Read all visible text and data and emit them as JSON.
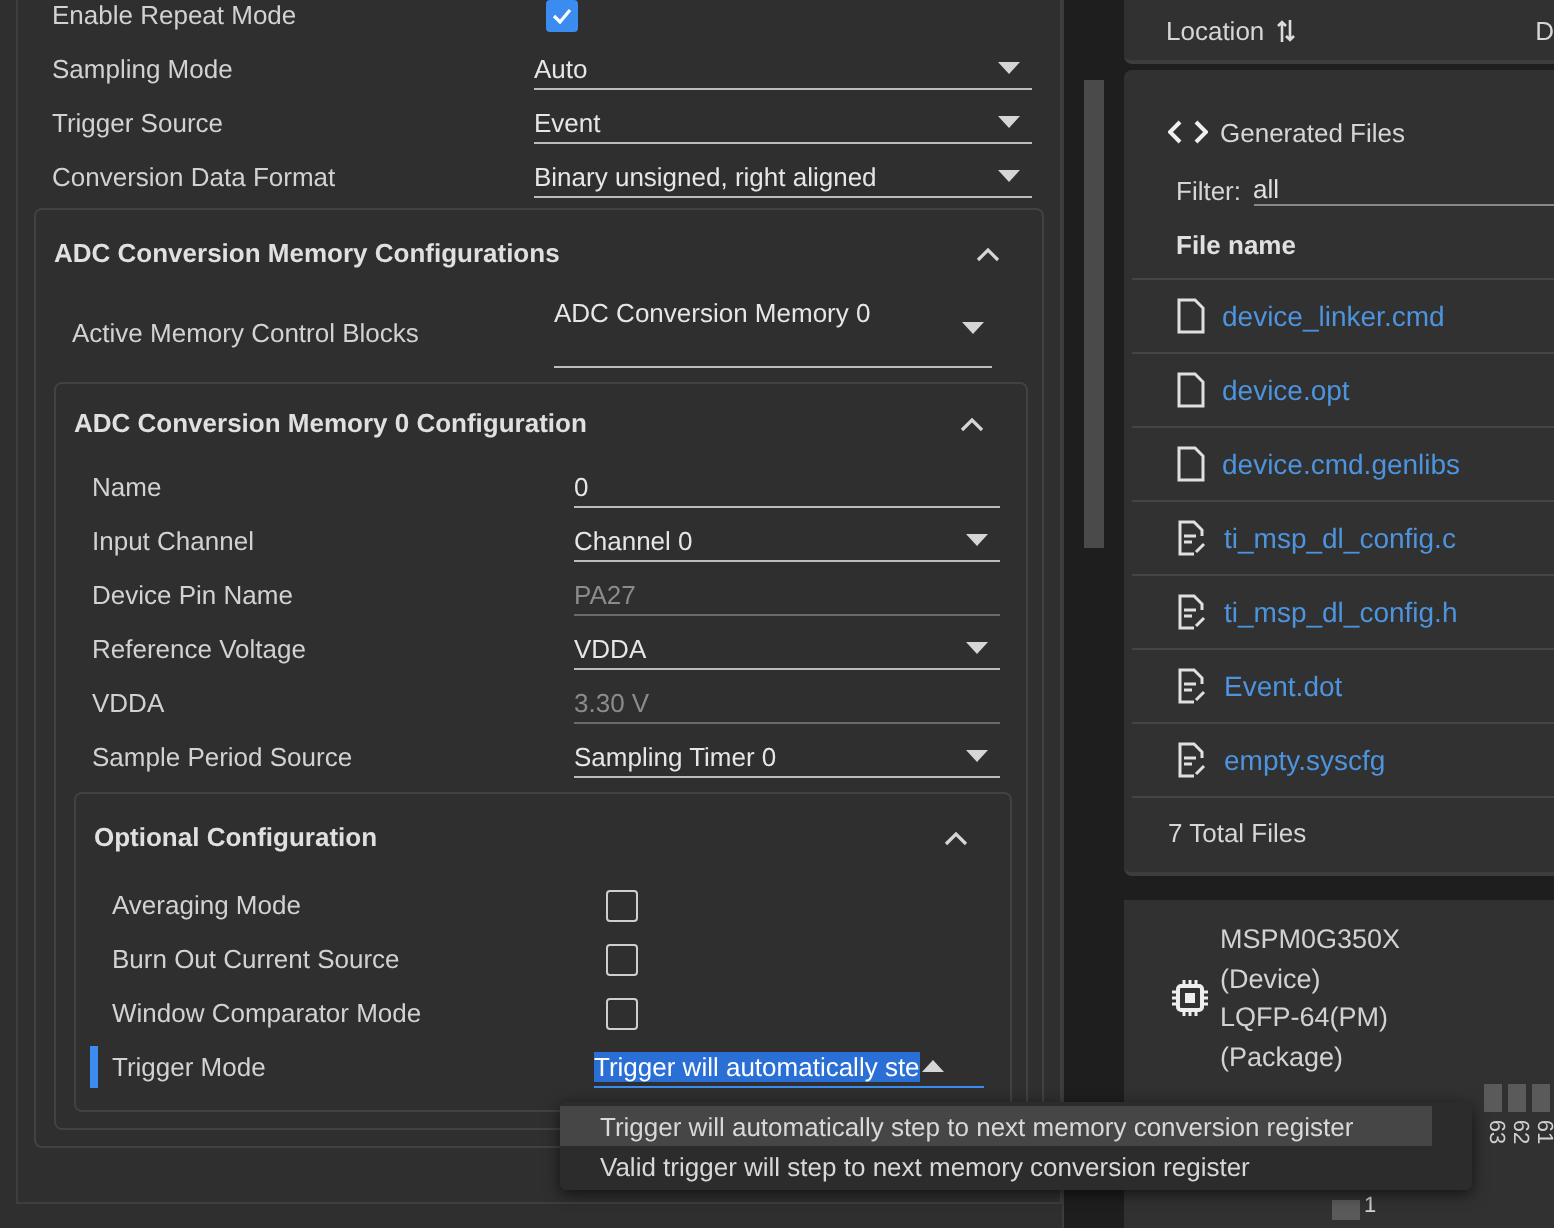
{
  "settings": [
    {
      "kind": "checkbox",
      "label": "Enable Repeat Mode",
      "checked": true
    },
    {
      "kind": "select",
      "label": "Sampling Mode",
      "value": "Auto"
    },
    {
      "kind": "select",
      "label": "Trigger Source",
      "value": "Event"
    },
    {
      "kind": "select",
      "label": "Conversion Data Format",
      "value": "Binary unsigned, right aligned"
    }
  ],
  "memory_configurations": {
    "title": "ADC Conversion Memory Configurations",
    "expanded": true,
    "active_blocks": {
      "label": "Active Memory Control Blocks",
      "value": "ADC Conversion Memory 0"
    },
    "memory_0": {
      "title": "ADC Conversion Memory 0 Configuration",
      "expanded": true,
      "fields": [
        {
          "kind": "text",
          "label": "Name",
          "value": "0"
        },
        {
          "kind": "select",
          "label": "Input Channel",
          "value": "Channel 0"
        },
        {
          "kind": "readonly",
          "label": "Device Pin Name",
          "value": "PA27"
        },
        {
          "kind": "select",
          "label": "Reference Voltage",
          "value": "VDDA"
        },
        {
          "kind": "readonly",
          "label": "VDDA",
          "value": "3.30 V"
        },
        {
          "kind": "select",
          "label": "Sample Period Source",
          "value": "Sampling Timer 0"
        }
      ],
      "optional": {
        "title": "Optional Configuration",
        "expanded": true,
        "fields": [
          {
            "kind": "checkbox",
            "label": "Averaging Mode",
            "checked": false
          },
          {
            "kind": "checkbox",
            "label": "Burn Out Current Source",
            "checked": false
          },
          {
            "kind": "checkbox",
            "label": "Window Comparator Mode",
            "checked": false
          },
          {
            "kind": "select",
            "label": "Trigger Mode",
            "value": "Trigger will automatically ste",
            "focused": true
          }
        ]
      }
    }
  },
  "dropdown_menu": {
    "options": [
      {
        "label": "Trigger will automatically step to next memory conversion register",
        "selected": true
      },
      {
        "label": "Valid trigger will step to next memory conversion register",
        "selected": false
      }
    ]
  },
  "location_card": {
    "label": "Location",
    "column_2": "D"
  },
  "generated_files": {
    "title": "Generated Files",
    "filter_label": "Filter:",
    "filter_value": "all",
    "column": "File name",
    "files": [
      {
        "name": "device_linker.cmd",
        "kind": "plain"
      },
      {
        "name": "device.opt",
        "kind": "plain"
      },
      {
        "name": "device.cmd.genlibs",
        "kind": "plain"
      },
      {
        "name": "ti_msp_dl_config.c",
        "kind": "code"
      },
      {
        "name": "ti_msp_dl_config.h",
        "kind": "code"
      },
      {
        "name": "Event.dot",
        "kind": "code"
      },
      {
        "name": "empty.syscfg",
        "kind": "code"
      }
    ],
    "total": "7 Total Files"
  },
  "device_card": {
    "lines": [
      "MSPM0G350X",
      "(Device)",
      "LQFP-64(PM)",
      "(Package)"
    ],
    "top_pins": [
      "63",
      "62",
      "61"
    ],
    "side_pins": [
      "1"
    ]
  }
}
